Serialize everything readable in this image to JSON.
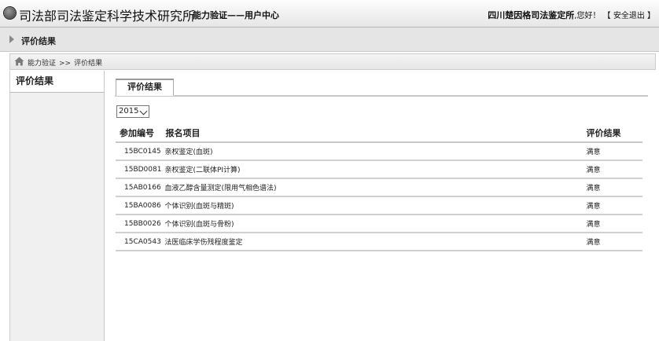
{
  "header": {
    "app_title": "司法部司法鉴定科学技术研究所",
    "subtitle": "能力验证——用户中心",
    "user_org": "四川楚因格司法鉴定所",
    "greeting": ",您好！",
    "logout_label": "【 安全退出 】"
  },
  "section": {
    "title": "评价结果"
  },
  "breadcrumb": {
    "items": [
      "能力验证",
      ">>",
      "评价结果"
    ]
  },
  "sidebar": {
    "items": [
      {
        "label": "评价结果"
      }
    ]
  },
  "main": {
    "tab_label": "评价结果",
    "year_select": {
      "value": "2015"
    },
    "table": {
      "headers": [
        "参加编号",
        "报名项目",
        "评价结果"
      ],
      "rows": [
        [
          "15BC0145",
          "亲权鉴定(血斑)",
          "满意"
        ],
        [
          "15BD0081",
          "亲权鉴定(二联体PI计算)",
          "满意"
        ],
        [
          "15AB0166",
          "血液乙醇含量测定(限用气相色谱法)",
          "满意"
        ],
        [
          "15BA0086",
          "个体识别(血斑与精斑)",
          "满意"
        ],
        [
          "15BB0026",
          "个体识别(血斑与骨粉)",
          "满意"
        ],
        [
          "15CA0543",
          "法医临床学伤残程度鉴定",
          "满意"
        ]
      ]
    }
  }
}
